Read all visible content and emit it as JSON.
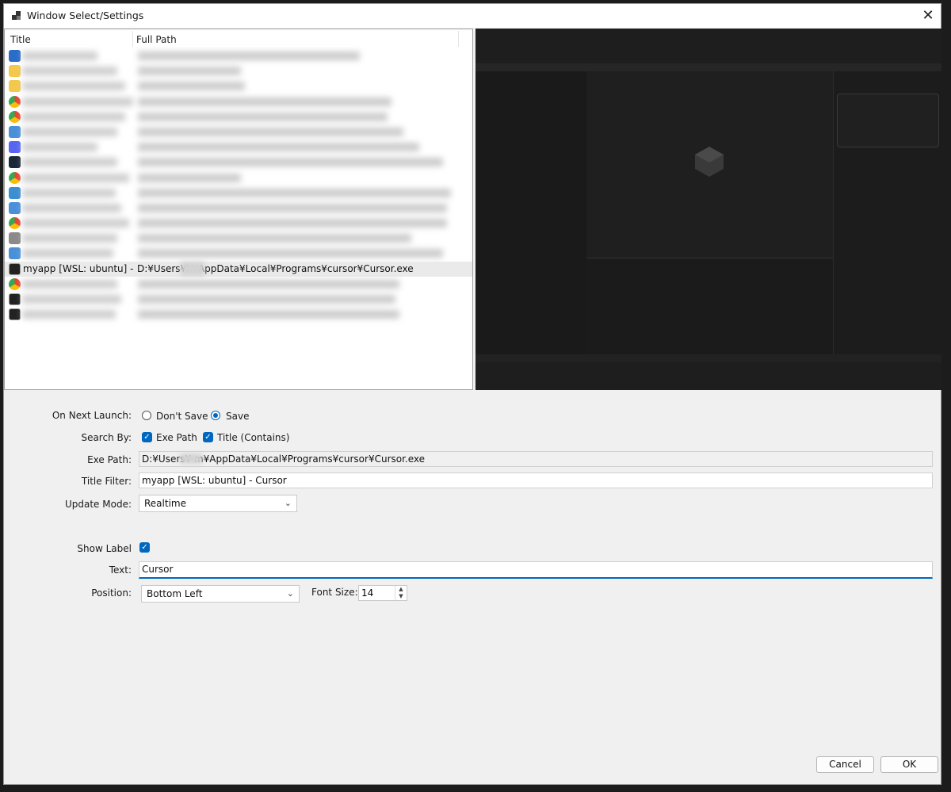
{
  "window": {
    "title": "Window Select/Settings"
  },
  "list": {
    "columns": [
      "Title",
      "Full Path"
    ],
    "selected_row": {
      "title": "myapp [WSL: ubuntu] - ...",
      "path": "D:¥Users¥i        ¥AppData¥Local¥Programs¥cursor¥Cursor.exe"
    },
    "row_icons": [
      "app-window-icon",
      "folder-icon",
      "folder-icon",
      "chrome-icon",
      "chrome-icon",
      "window-icon",
      "discord-icon",
      "steam-icon",
      "chrome-icon",
      "remote-desktop-icon",
      "window-icon",
      "chrome-icon",
      "settings-icon",
      "window-icon",
      "cursor-icon",
      "chrome-icon",
      "cursor-icon",
      "cursor-icon"
    ]
  },
  "settings": {
    "on_next_launch_label": "On Next Launch:",
    "dont_save": "Don't Save",
    "save": "Save",
    "search_by_label": "Search By:",
    "exe_path_option": "Exe Path",
    "title_option": "Title (Contains)",
    "exe_path_label": "Exe Path:",
    "exe_path_value": "D:¥Users¥        m¥AppData¥Local¥Programs¥cursor¥Cursor.exe",
    "title_filter_label": "Title Filter:",
    "title_filter_value": "myapp [WSL: ubuntu] - Cursor",
    "update_mode_label": "Update Mode:",
    "update_mode_value": "Realtime",
    "show_label_label": "Show Label",
    "text_label": "Text:",
    "text_value": "Cursor",
    "position_label": "Position:",
    "position_value": "Bottom Left",
    "font_size_label": "Font Size:",
    "font_size_value": "14"
  },
  "buttons": {
    "cancel": "Cancel",
    "ok": "OK"
  },
  "colors": {
    "accent": "#0067c0",
    "background": "#f0f0f0"
  }
}
